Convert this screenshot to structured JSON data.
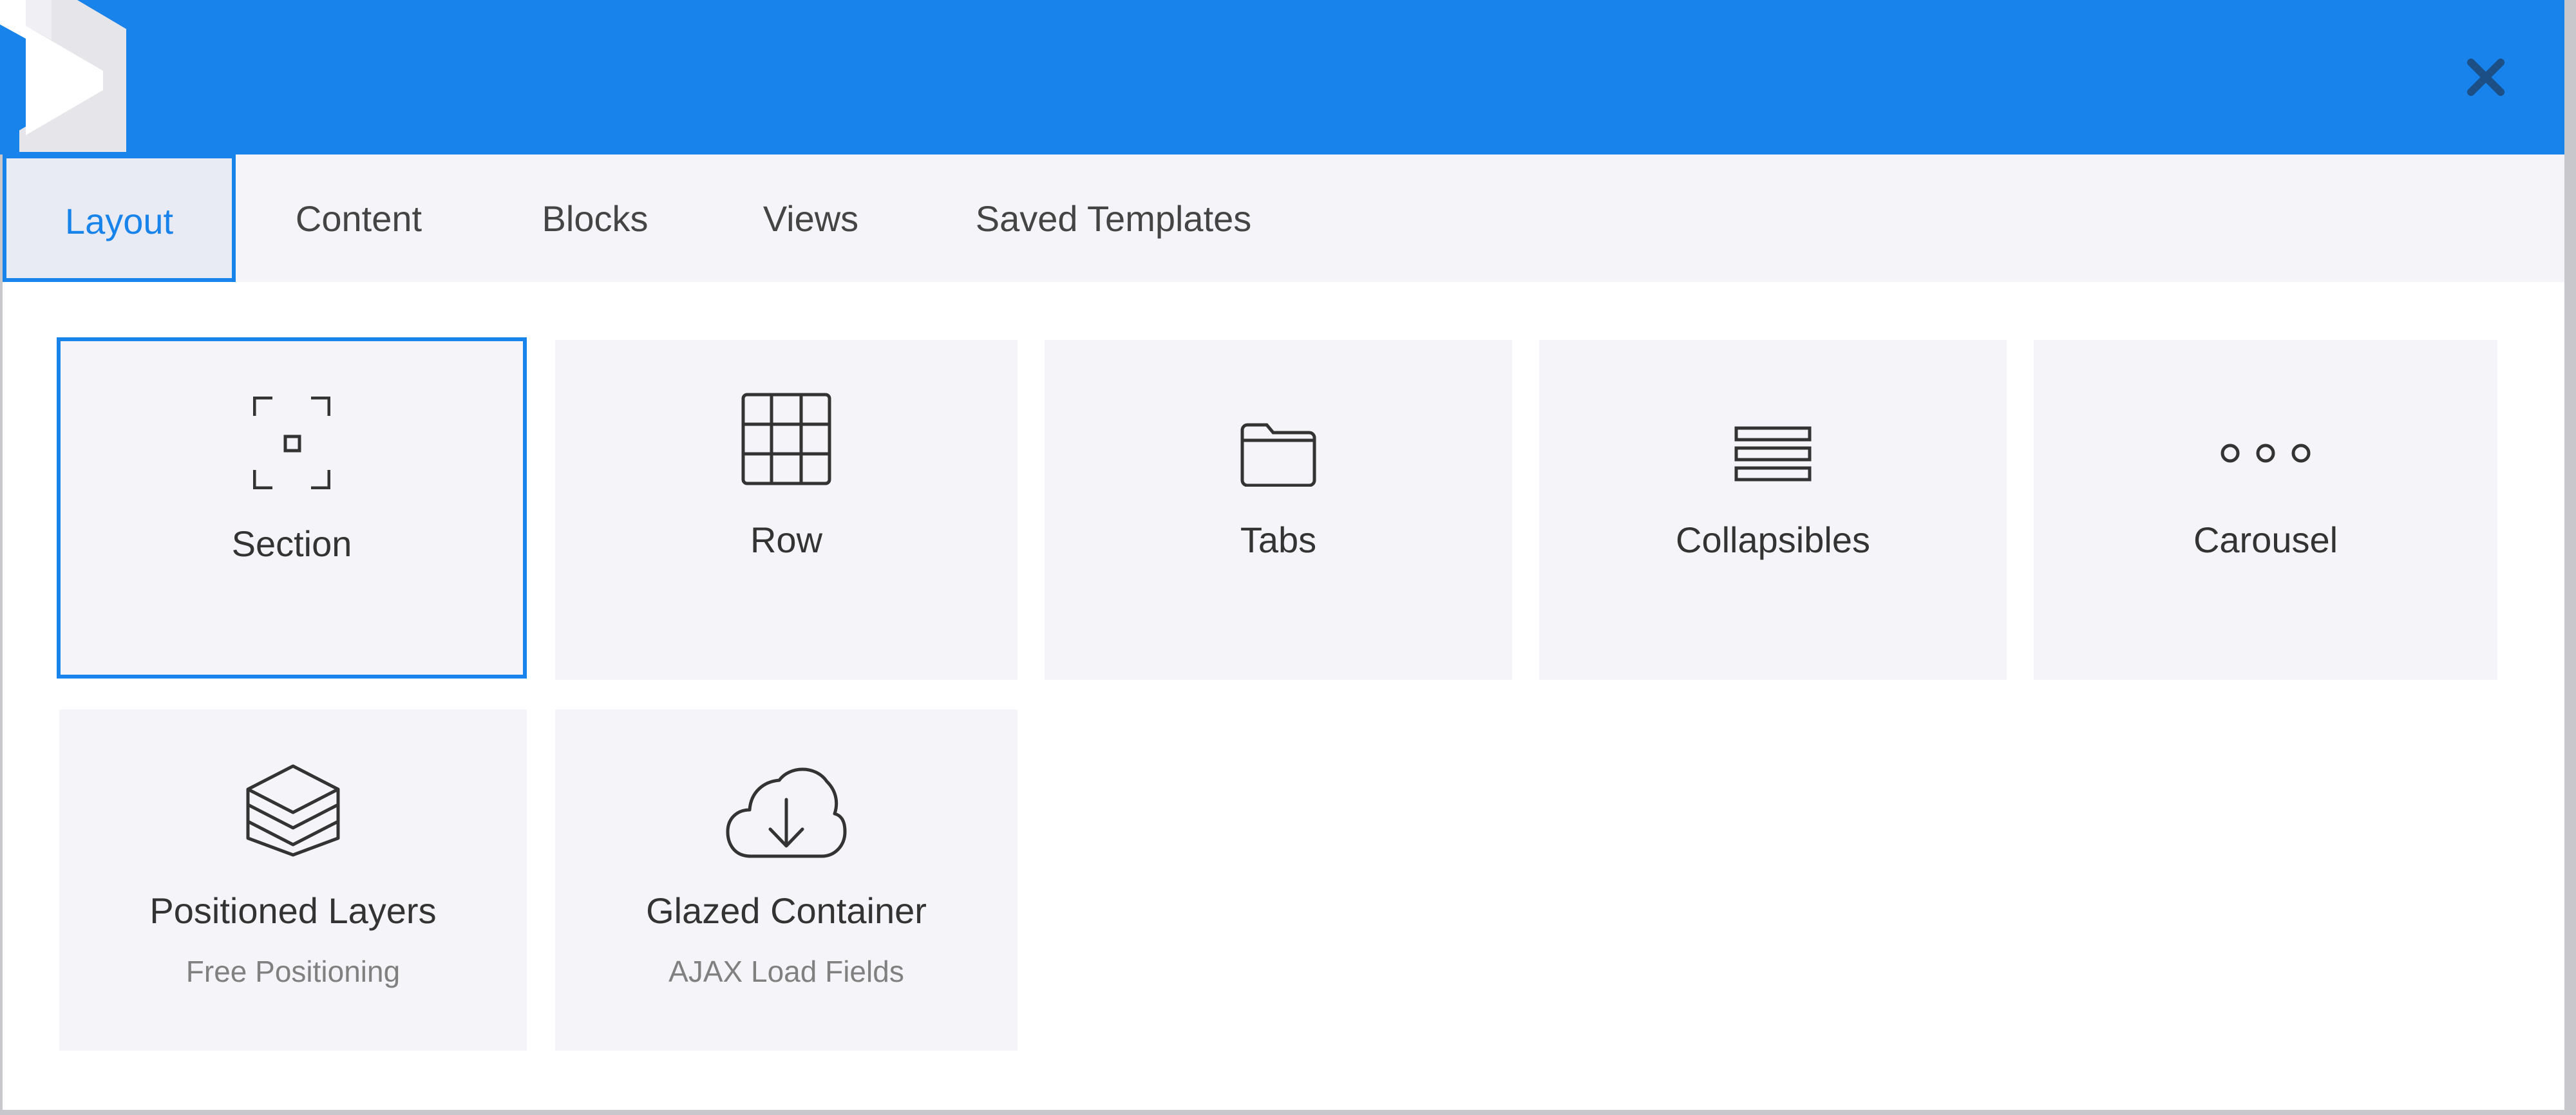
{
  "header": {
    "logo_icon": "shield-logo-icon",
    "close_icon": "close-icon",
    "background_color": "#1883ea"
  },
  "tabs": [
    {
      "label": "Layout",
      "active": true
    },
    {
      "label": "Content",
      "active": false
    },
    {
      "label": "Blocks",
      "active": false
    },
    {
      "label": "Views",
      "active": false
    },
    {
      "label": "Saved Templates",
      "active": false
    }
  ],
  "elements": [
    {
      "title": "Section",
      "icon": "section-frame-icon",
      "selected": true
    },
    {
      "title": "Row",
      "icon": "grid-icon",
      "selected": false
    },
    {
      "title": "Tabs",
      "icon": "folder-icon",
      "selected": false
    },
    {
      "title": "Collapsibles",
      "icon": "stacked-bars-icon",
      "selected": false
    },
    {
      "title": "Carousel",
      "icon": "three-dots-icon",
      "selected": false
    },
    {
      "title": "Positioned Layers",
      "subtitle": "Free Positioning",
      "icon": "layers-icon",
      "selected": false
    },
    {
      "title": "Glazed Container",
      "subtitle": "AJAX Load Fields",
      "icon": "cloud-download-icon",
      "selected": false
    }
  ],
  "colors": {
    "accent": "#1883ea",
    "card_background": "#f5f5f9",
    "text": "#333333",
    "subtext": "#808080"
  }
}
